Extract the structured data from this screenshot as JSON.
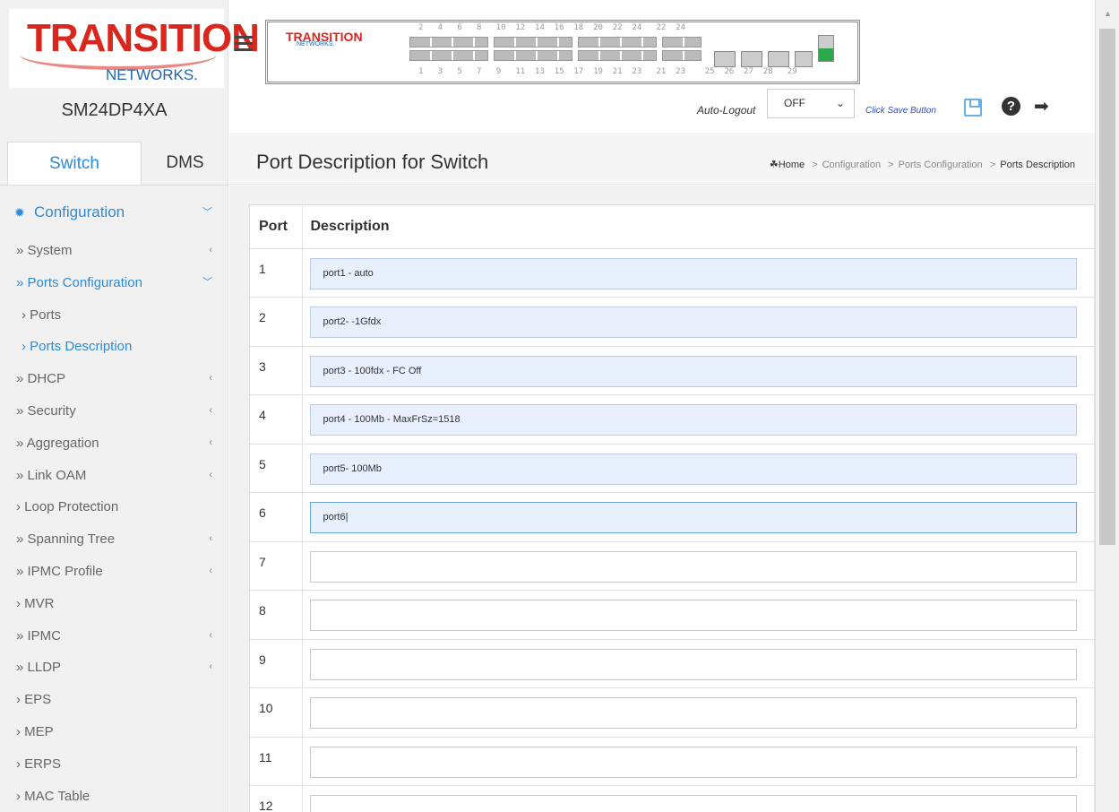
{
  "brand": {
    "line1": "TRANSITION",
    "line2": "NETWORKS.",
    "model": "SM24DP4XA",
    "colors": {
      "red": "#d9271e",
      "blue": "#1e66b0",
      "accent": "#2d8bd8"
    }
  },
  "panel": {
    "top_numbers": "2   4   6   8   10  12  14  16  18  20  22  24   22  24",
    "bottom_numbers": "1   3   5   7   9   11  13  15  17  19  21  23   21  23    25  26  27  28   29"
  },
  "toolbar": {
    "autologout_label": "Auto-Logout",
    "autologout_value": "OFF",
    "save_hint": "Click Save Button",
    "icons": [
      "save-icon",
      "help-icon",
      "logout-icon"
    ]
  },
  "sidebar": {
    "tabs": [
      "Switch",
      "DMS"
    ],
    "section": "Configuration",
    "items": [
      "» System",
      "» Ports Configuration",
      "› Ports",
      "› Ports Description",
      "» DHCP",
      "» Security",
      "» Aggregation",
      "» Link OAM",
      "› Loop Protection",
      "» Spanning Tree",
      "» IPMC Profile",
      "› MVR",
      "» IPMC",
      "» LLDP",
      "› EPS",
      "› MEP",
      "› ERPS",
      "› MAC Table"
    ]
  },
  "page": {
    "title": "Port Description for Switch",
    "breadcrumb": [
      "Home",
      "Configuration",
      "Ports Configuration",
      "Ports Description"
    ]
  },
  "table": {
    "columns": [
      "Port",
      "Description"
    ],
    "rows": [
      {
        "port": "1",
        "description": "port1 - auto"
      },
      {
        "port": "2",
        "description": "port2- -1Gfdx"
      },
      {
        "port": "3",
        "description": "port3 - 100fdx - FC Off"
      },
      {
        "port": "4",
        "description": "port4 - 100Mb - MaxFrSz=1518"
      },
      {
        "port": "5",
        "description": "port5- 100Mb"
      },
      {
        "port": "6",
        "description": "port6|"
      },
      {
        "port": "7",
        "description": ""
      },
      {
        "port": "8",
        "description": ""
      },
      {
        "port": "9",
        "description": ""
      },
      {
        "port": "10",
        "description": ""
      },
      {
        "port": "11",
        "description": ""
      },
      {
        "port": "12",
        "description": ""
      }
    ]
  }
}
